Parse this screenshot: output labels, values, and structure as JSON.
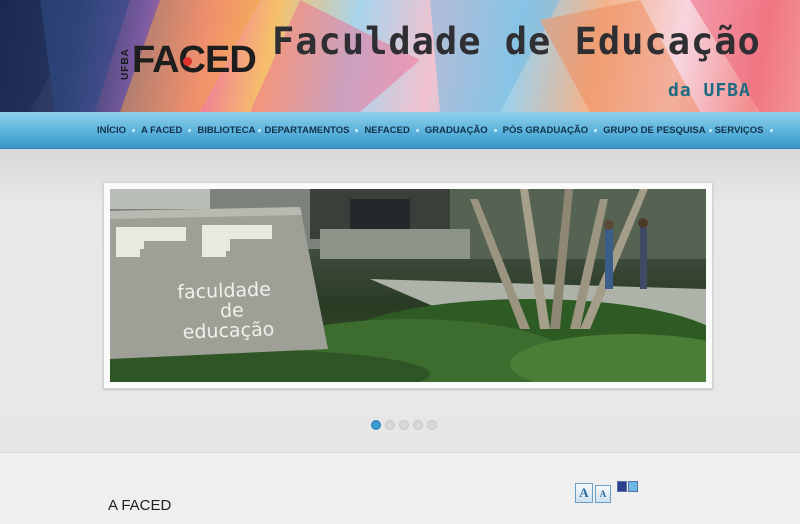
{
  "header": {
    "logo_prefix": "UFBA",
    "logo_text": "FACED",
    "title": "Faculdade de Educação",
    "subtitle": "da UFBA"
  },
  "nav": {
    "items": [
      {
        "label": "INÍCIO"
      },
      {
        "label": "A FACED"
      },
      {
        "label": "BIBLIOTECA"
      },
      {
        "label": "DEPARTAMENTOS"
      },
      {
        "label": "NEFACED"
      },
      {
        "label": "GRADUAÇÃO"
      },
      {
        "label": "PÓS GRADUAÇÃO"
      },
      {
        "label": "GRUPO DE PESQUISA"
      },
      {
        "label": "SERVIÇOS"
      }
    ]
  },
  "slideshow": {
    "sign_text": [
      "faculdade",
      "de",
      "educação"
    ],
    "slide_count": 5,
    "active_slide": 1
  },
  "content": {
    "section_title": "A FACED",
    "font_increase_label": "A",
    "font_decrease_label": "A"
  },
  "colors": {
    "nav_bar": "#5ab2dc",
    "active_dot": "#3a9bd0",
    "logo_dot": "#e0322d",
    "subtitle": "#1d6c84"
  }
}
